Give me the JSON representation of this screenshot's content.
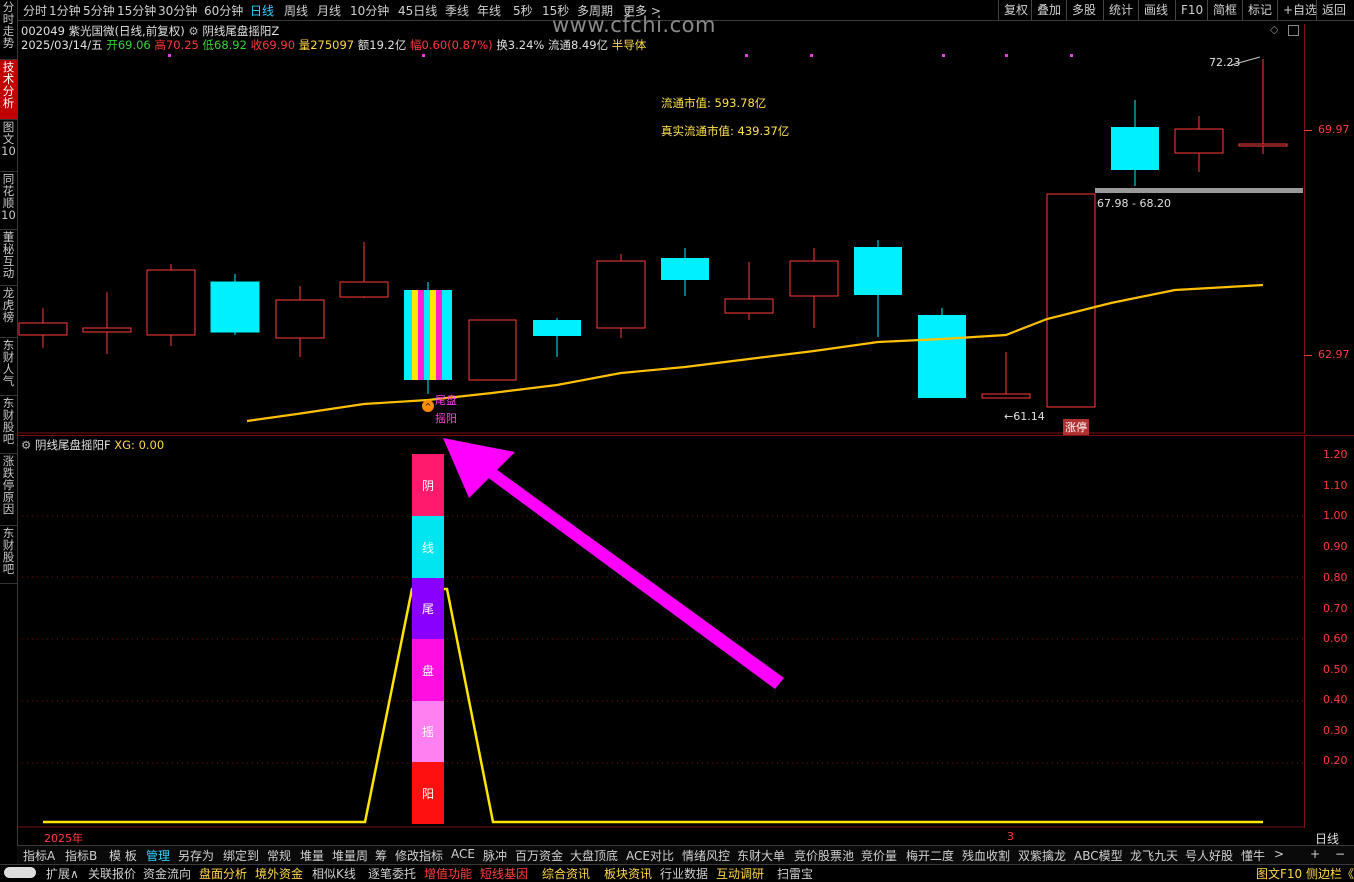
{
  "periods": [
    "分时",
    "1分钟",
    "5分钟",
    "15分钟",
    "30分钟",
    "60分钟",
    "日线",
    "周线",
    "月线",
    "10分钟",
    "45日线",
    "季线",
    "年线",
    "5秒",
    "15秒",
    "多周期",
    "更多 >"
  ],
  "active_period": "日线",
  "right_tools": [
    "复权",
    "叠加",
    "多股",
    "统计",
    "画线",
    "F10",
    "简框",
    "标记",
    "+自选",
    "返回"
  ],
  "left_tabs": [
    "分时走势",
    "技术分析",
    "图文10",
    "同花顺10",
    "董秘互动",
    "龙虎榜",
    "东财人气",
    "东财股吧",
    "涨跌停原因",
    "东财股吧"
  ],
  "watermark": "www.cfchi.com",
  "stock": {
    "code": "002049",
    "name": "紫光国微(日线,前复权)",
    "indicator": "阴线尾盘摇阳Z",
    "date": "2025/03/14/五",
    "open_label": "开",
    "open": "69.06",
    "high_label": "高",
    "high": "70.25",
    "low_label": "低",
    "low": "68.92",
    "close_label": "收",
    "close": "69.90",
    "vol_label": "量",
    "vol": "275097",
    "amt": "额19.2亿",
    "chg": "幅0.60(0.87%)",
    "turnover": "换3.24%",
    "float": "流通8.49亿",
    "sector": "半导体"
  },
  "annotations": {
    "mkt_cap": "流通市值: 593.78亿",
    "real_cap": "真实流通市值: 439.37亿",
    "high_mark": "72.23",
    "low_mark": "61.14",
    "gap": "67.98 - 68.20",
    "limit_up": "涨停",
    "signal_1": "尾盘",
    "signal_2": "摇阳"
  },
  "price_axis": [
    "69.97",
    "62.97"
  ],
  "sub_title": "阴线尾盘摇阳F",
  "sub_xg": "XG: 0.00",
  "sub_axis": [
    "1.20",
    "1.10",
    "1.00",
    "0.90",
    "0.80",
    "0.70",
    "0.60",
    "0.50",
    "0.40",
    "0.30",
    "0.20"
  ],
  "bar_chars": [
    "阴",
    "线",
    "尾",
    "盘",
    "摇",
    "阳"
  ],
  "bar_colors": [
    "#ff1a6e",
    "#00e5f0",
    "#8a00ff",
    "#ff10e0",
    "#ff80f0",
    "#ff1010"
  ],
  "x_label_left": "2025年",
  "x_label_mid": "3",
  "period_right": "日线",
  "indicator_tabs": [
    "指标A",
    "指标B",
    "模 板",
    "管理",
    "另存为",
    "绑定到",
    "常规",
    "堆量",
    "堆量周",
    "筹",
    "修改指标",
    "ACE",
    "脉冲",
    "百万资金",
    "大盘顶底",
    "ACE对比",
    "情绪风控",
    "东财大单",
    "竞价股票池",
    "竞价量",
    "梅开二度",
    "残血收割",
    "双紫擒龙",
    "ABC模型",
    "龙飞九天",
    "号人好股",
    "懂牛",
    ">"
  ],
  "indicator_selected": "管理",
  "zoom": [
    "+",
    "−"
  ],
  "bottom_items": [
    "扩展∧",
    "关联报价",
    "资金流向",
    "盘面分析",
    "境外资金",
    "相似K线",
    "逐笔委托",
    "增值功能",
    "短线基因",
    "综合资讯",
    "板块资讯",
    "行业数据",
    "互动调研",
    "扫雷宝"
  ],
  "bottom_right": "图文F10 侧边栏《"
}
